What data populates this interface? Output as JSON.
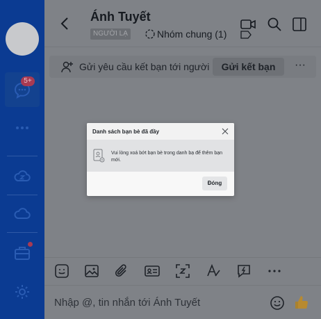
{
  "rail": {
    "items": [
      "avatar",
      "messages-icon",
      "more-dots-icon",
      "zcloud-icon",
      "cloud-icon",
      "toolbox-icon",
      "settings-icon"
    ],
    "badge": "5+"
  },
  "header": {
    "title": "Ánh Tuyết",
    "stranger_tag": "NGƯỜI LẠ",
    "group_label": "Nhóm chung (1)"
  },
  "request_bar": {
    "text": "Gửi yêu cầu kết bạn tới người",
    "button": "Gửi kết bạn",
    "more": "···"
  },
  "composer": {
    "placeholder": "Nhập @, tin nhắn tới Ánh Tuyết"
  },
  "modal": {
    "title": "Danh sách bạn bè đã đầy",
    "message": "Vui lòng xoá bớt bạn bè trong danh bạ để thêm bạn mới.",
    "button": "Đóng"
  },
  "colors": {
    "rail": "#0b3b92",
    "overlay_bg": "#7f8287",
    "badge": "#a83a52"
  }
}
